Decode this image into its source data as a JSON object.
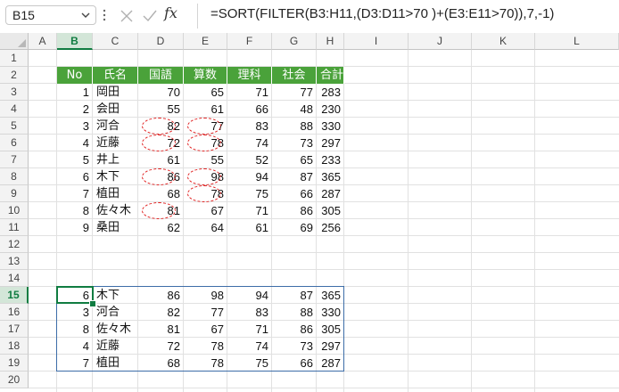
{
  "formula_bar": {
    "name_box": "B15",
    "formula": "=SORT(FILTER(B3:H11,(D3:D11>70 )+(E3:E11>70)),7,-1)",
    "fx_label": "fx"
  },
  "columns": [
    "A",
    "B",
    "C",
    "D",
    "E",
    "F",
    "G",
    "H",
    "I",
    "J",
    "K",
    "L"
  ],
  "rows": [
    "1",
    "2",
    "3",
    "4",
    "5",
    "6",
    "7",
    "8",
    "9",
    "10",
    "11",
    "12",
    "13",
    "14",
    "15",
    "16",
    "17",
    "18",
    "19",
    "20"
  ],
  "table": {
    "headers": [
      "No",
      "氏名",
      "国語",
      "算数",
      "理科",
      "社会",
      "合計"
    ],
    "rows": [
      [
        "1",
        "岡田",
        "70",
        "65",
        "71",
        "77",
        "283"
      ],
      [
        "2",
        "会田",
        "55",
        "61",
        "66",
        "48",
        "230"
      ],
      [
        "3",
        "河合",
        "82",
        "77",
        "83",
        "88",
        "330"
      ],
      [
        "4",
        "近藤",
        "72",
        "78",
        "74",
        "73",
        "297"
      ],
      [
        "5",
        "井上",
        "61",
        "55",
        "52",
        "65",
        "233"
      ],
      [
        "6",
        "木下",
        "86",
        "98",
        "94",
        "87",
        "365"
      ],
      [
        "7",
        "植田",
        "68",
        "78",
        "75",
        "66",
        "287"
      ],
      [
        "8",
        "佐々木",
        "81",
        "67",
        "71",
        "86",
        "305"
      ],
      [
        "9",
        "桑田",
        "62",
        "64",
        "61",
        "69",
        "256"
      ]
    ]
  },
  "result": {
    "rows": [
      [
        "6",
        "木下",
        "86",
        "98",
        "94",
        "87",
        "365"
      ],
      [
        "3",
        "河合",
        "82",
        "77",
        "83",
        "88",
        "330"
      ],
      [
        "8",
        "佐々木",
        "81",
        "67",
        "71",
        "86",
        "305"
      ],
      [
        "4",
        "近藤",
        "72",
        "78",
        "74",
        "73",
        "297"
      ],
      [
        "7",
        "植田",
        "68",
        "78",
        "75",
        "66",
        "287"
      ]
    ]
  },
  "colors": {
    "header_fill": "#4aa23a",
    "selection": "#107c41",
    "highlight_ring": "#e02020",
    "result_border": "#3d6da8"
  }
}
